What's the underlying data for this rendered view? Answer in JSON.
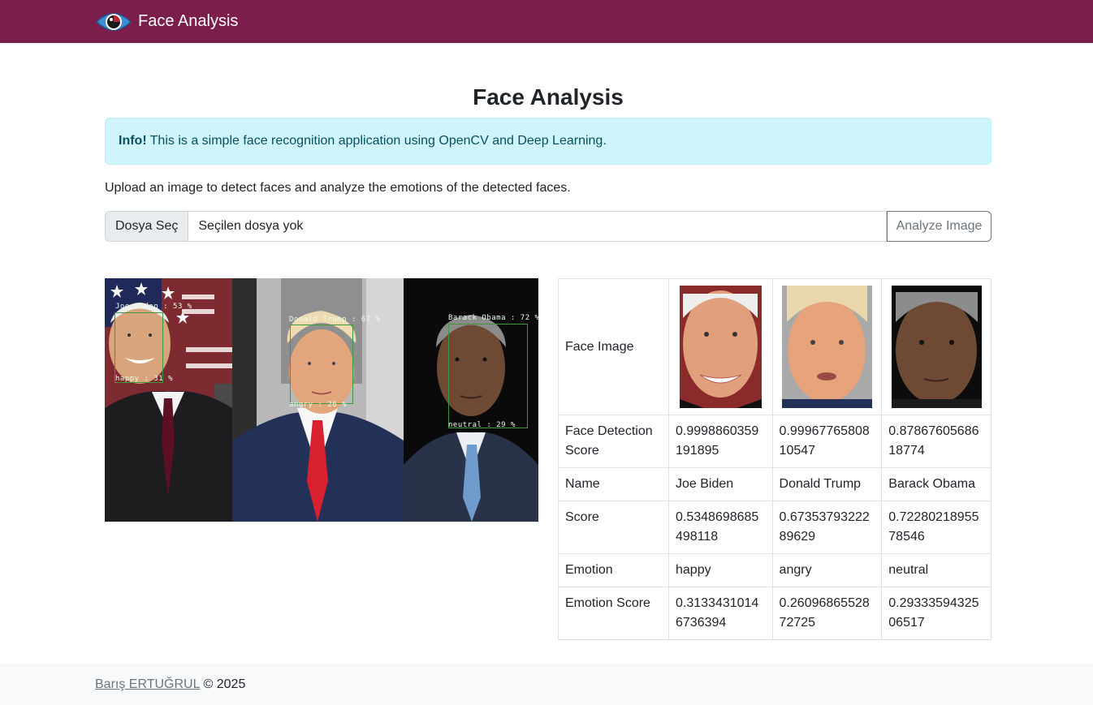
{
  "navbar": {
    "brand": "Face Analysis",
    "logo_icon": "eye-icon"
  },
  "page": {
    "title": "Face Analysis",
    "alert": {
      "strong": "Info!",
      "text": "This is a simple face recognition application using OpenCV and Deep Learning."
    },
    "lead": "Upload an image to detect faces and analyze the emotions of the detected faces.",
    "upload": {
      "choose_label": "Dosya Seç",
      "file_name": "Seçilen dosya yok",
      "analyze_label": "Analyze Image"
    }
  },
  "image_overlays": {
    "biden_name": "Joe Biden : 53 %",
    "biden_emotion": "happy : 31 %",
    "trump_name": "Donald Trump : 67 %",
    "trump_emotion": "angry : 26 %",
    "obama_name": "Barack Obama : 72 %",
    "obama_emotion": "neutral : 29 %"
  },
  "table": {
    "row_labels": {
      "face_image": "Face Image",
      "detection": "Face Detection Score",
      "name": "Name",
      "score": "Score",
      "emotion": "Emotion",
      "emotion_score": "Emotion Score"
    },
    "faces": [
      {
        "detection": "0.9998860359191895",
        "name": "Joe Biden",
        "score": "0.5348698685498118",
        "emotion": "happy",
        "emotion_score": "0.31334310146736394"
      },
      {
        "detection": "0.9996776580810547",
        "name": "Donald Trump",
        "score": "0.6735379322289629",
        "emotion": "angry",
        "emotion_score": "0.2609686552872725"
      },
      {
        "detection": "0.8786760568618774",
        "name": "Barack Obama",
        "score": "0.7228021895578546",
        "emotion": "neutral",
        "emotion_score": "0.2933359432506517"
      }
    ]
  },
  "footer": {
    "author": "Barış ERTUĞRUL",
    "copyright": "© 2025"
  },
  "colors": {
    "navbar": "#7b1e4b",
    "alert_bg": "#cff4fc",
    "alert_text": "#055160"
  }
}
